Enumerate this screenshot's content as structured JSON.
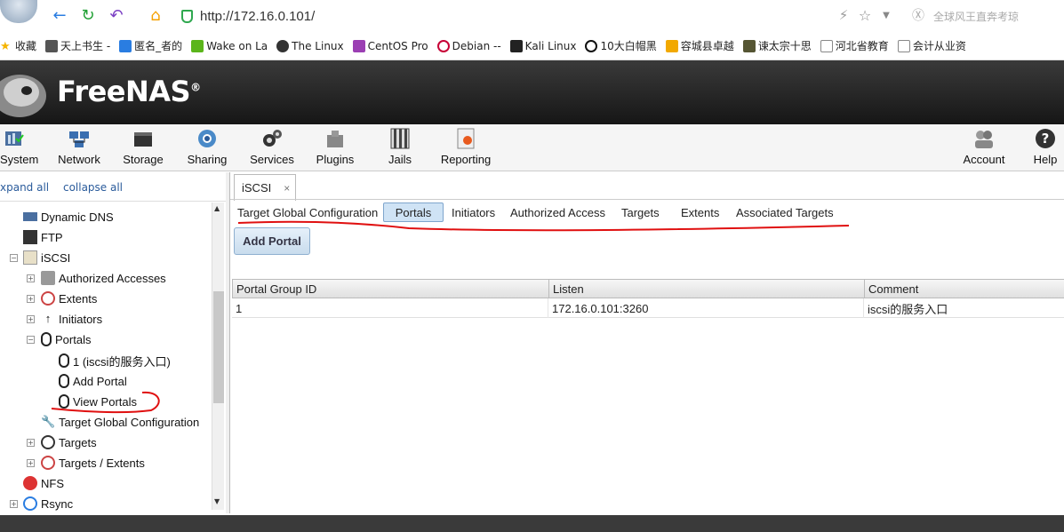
{
  "browser": {
    "url": "http://172.16.0.101/",
    "search_hint": "全球风王直奔考琼",
    "bookmarks": [
      {
        "label": "收藏",
        "icon": "star-icon",
        "color": "#f5b400"
      },
      {
        "label": "天上书生 -",
        "icon": "bookmark-icon",
        "color": "#555555"
      },
      {
        "label": "匿名_者的",
        "icon": "bookmark-icon",
        "color": "#2a7de1"
      },
      {
        "label": "Wake on La",
        "icon": "bookmark-icon",
        "color": "#5bb51b"
      },
      {
        "label": "The Linux",
        "icon": "tux-icon",
        "color": "#333333"
      },
      {
        "label": "CentOS Pro",
        "icon": "centos-icon",
        "color": "#9b3fb3"
      },
      {
        "label": "Debian --",
        "icon": "debian-icon",
        "color": "#c70036"
      },
      {
        "label": "Kali Linux",
        "icon": "kali-icon",
        "color": "#222222"
      },
      {
        "label": "10大白帽黑",
        "icon": "bookmark-icon",
        "color": "#111111"
      },
      {
        "label": "容城县卓越",
        "icon": "bookmark-icon",
        "color": "#f2a900"
      },
      {
        "label": "谏太宗十思",
        "icon": "bookmark-icon",
        "color": "#555533"
      },
      {
        "label": "河北省教育",
        "icon": "page-icon",
        "color": "#888888"
      },
      {
        "label": "会计从业资",
        "icon": "page-icon",
        "color": "#888888"
      }
    ]
  },
  "app": {
    "logo": "FreeNAS",
    "logo_mark": "®"
  },
  "toolbar": {
    "items": [
      {
        "label": "System",
        "icon": "system-icon"
      },
      {
        "label": "Network",
        "icon": "network-icon"
      },
      {
        "label": "Storage",
        "icon": "storage-icon"
      },
      {
        "label": "Sharing",
        "icon": "sharing-icon"
      },
      {
        "label": "Services",
        "icon": "services-icon"
      },
      {
        "label": "Plugins",
        "icon": "plugins-icon"
      },
      {
        "label": "Jails",
        "icon": "jails-icon"
      },
      {
        "label": "Reporting",
        "icon": "reporting-icon"
      },
      {
        "label": "Account",
        "icon": "account-icon"
      },
      {
        "label": "Help",
        "icon": "help-icon"
      }
    ]
  },
  "tree": {
    "expand_all": "xpand all",
    "collapse_all": "collapse all",
    "nodes": [
      {
        "label": "Dynamic DNS",
        "icon": "dns-icon"
      },
      {
        "label": "FTP",
        "icon": "ftp-icon"
      },
      {
        "label": "iSCSI",
        "icon": "iscsi-icon"
      },
      {
        "label": "Authorized Accesses",
        "icon": "lock-icon"
      },
      {
        "label": "Extents",
        "icon": "extents-icon"
      },
      {
        "label": "Initiators",
        "icon": "initiator-icon"
      },
      {
        "label": "Portals",
        "icon": "portal-icon"
      },
      {
        "label": "1 (iscsi的服务入口)",
        "icon": "portal-icon"
      },
      {
        "label": "Add Portal",
        "icon": "portal-add-icon"
      },
      {
        "label": "View Portals",
        "icon": "portal-view-icon"
      },
      {
        "label": "Target Global Configuration",
        "icon": "wrench-icon"
      },
      {
        "label": "Targets",
        "icon": "target-icon"
      },
      {
        "label": "Targets / Extents",
        "icon": "target-extent-icon"
      },
      {
        "label": "NFS",
        "icon": "nfs-icon"
      },
      {
        "label": "Rsync",
        "icon": "rsync-icon"
      }
    ]
  },
  "panel": {
    "tab": "iSCSI",
    "tab_close": "×",
    "subtabs": [
      "Target Global Configuration",
      "Portals",
      "Initiators",
      "Authorized Access",
      "Targets",
      "Extents",
      "Associated Targets"
    ],
    "add_button": "Add Portal",
    "grid": {
      "columns": [
        "Portal Group ID",
        "Listen",
        "Comment"
      ],
      "rows": [
        [
          "1",
          "172.16.0.101:3260",
          "iscsi的服务入口"
        ]
      ]
    }
  }
}
